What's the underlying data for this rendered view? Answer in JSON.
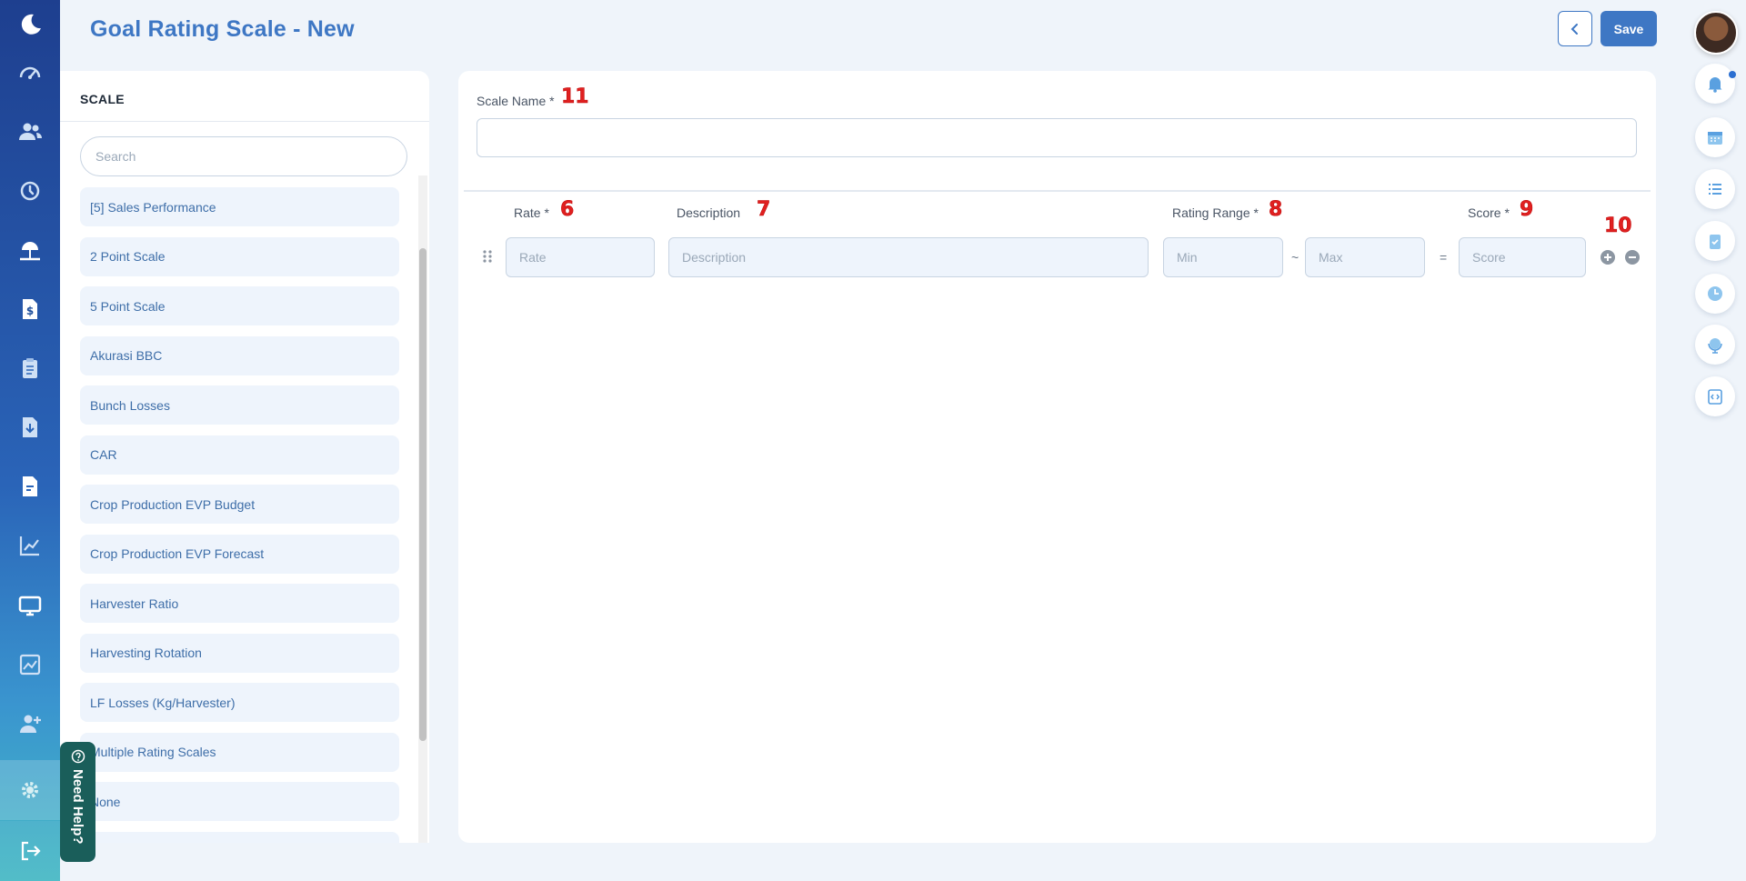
{
  "header": {
    "title": "Goal Rating Scale - New",
    "save_label": "Save"
  },
  "sidebar": {
    "heading": "SCALE",
    "search_placeholder": "Search",
    "items": [
      "[5] Sales Performance",
      "2 Point Scale",
      "5 Point Scale",
      "Akurasi BBC",
      "Bunch Losses",
      "CAR",
      "Crop Production EVP Budget",
      "Crop Production EVP Forecast",
      "Harvester Ratio",
      "Harvesting Rotation",
      "LF Losses (Kg/Harvester)",
      "Multiple Rating Scales",
      "None"
    ]
  },
  "help": {
    "label": "Need Help?"
  },
  "form": {
    "scale_name_label": "Scale Name *",
    "rate_label": "Rate *",
    "description_label": "Description",
    "rating_range_label": "Rating Range *",
    "score_label": "Score *",
    "rate_placeholder": "Rate",
    "description_placeholder": "Description",
    "min_placeholder": "Min",
    "max_placeholder": "Max",
    "score_placeholder": "Score",
    "tilde": "~",
    "equals": "="
  },
  "annotations": {
    "scale_name": "11",
    "rate": "6",
    "description": "7",
    "rating_range": "8",
    "score": "9",
    "row_actions": "10"
  },
  "colors": {
    "accent": "#3e77c4",
    "annotation": "#e02020",
    "help_bg": "#1a5e5a"
  },
  "icons": {
    "nav": [
      "moon-logo-icon",
      "dashboard-icon",
      "users-icon",
      "history-icon",
      "vacation-icon",
      "payroll-icon",
      "clipboard-icon",
      "download-icon",
      "document-icon",
      "chart-icon",
      "monitor-icon",
      "analytics-icon",
      "add-user-icon",
      "settings-icon",
      "logout-icon"
    ],
    "rail": [
      "notification-bell-icon",
      "calendar-icon",
      "list-icon",
      "task-check-icon",
      "clock-icon",
      "globe-icon",
      "code-clipboard-icon"
    ]
  }
}
